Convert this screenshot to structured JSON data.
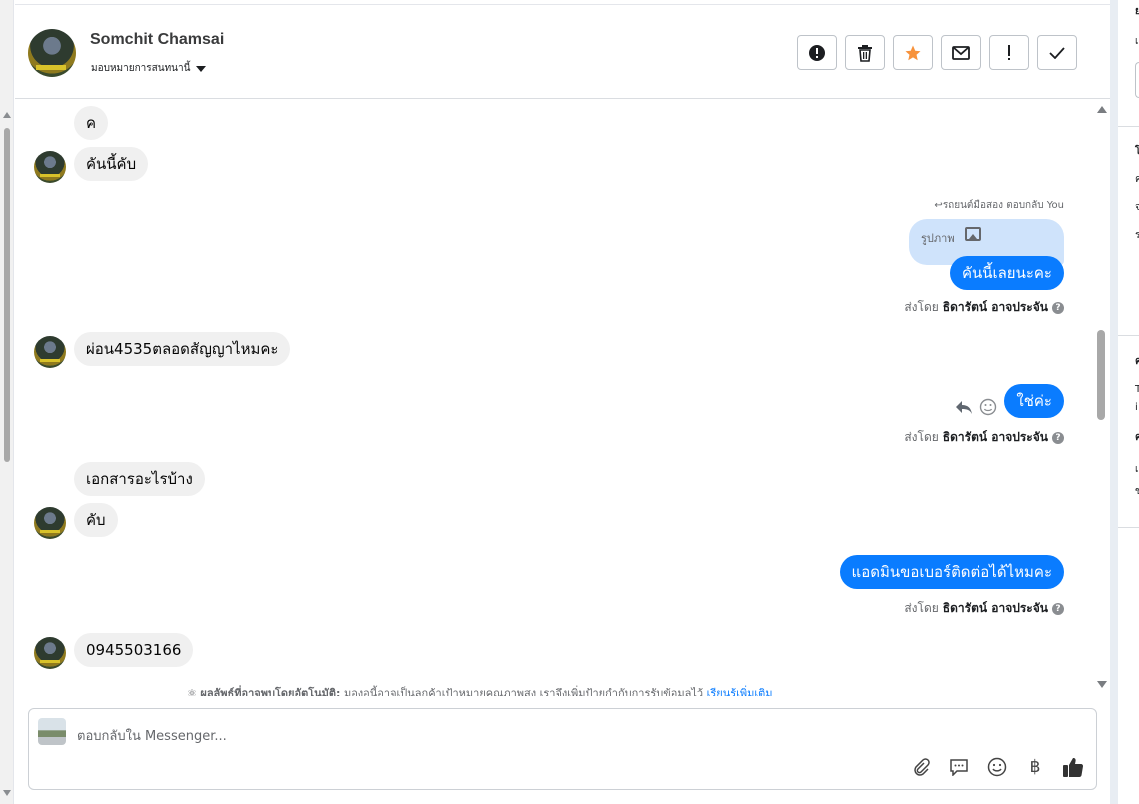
{
  "header": {
    "user_name": "Somchit Chamsai",
    "assign_label": "มอบหมายการสนทนานี้",
    "actions": [
      {
        "name": "spam-button",
        "icon": "alert-circle-icon"
      },
      {
        "name": "delete-button",
        "icon": "trash-icon"
      },
      {
        "name": "star-button",
        "icon": "star-icon"
      },
      {
        "name": "mark-unread-button",
        "icon": "envelope-icon"
      },
      {
        "name": "follow-up-button",
        "icon": "exclamation-icon"
      },
      {
        "name": "done-button",
        "icon": "check-icon"
      }
    ]
  },
  "messages": {
    "m1": "ค",
    "m2": "คันนี้คับ",
    "reply_note": "รถยนต์มือสอง ตอบกลับ You",
    "quoted_label": "รูปภาพ",
    "m3": "คันนี้เลยนะคะ",
    "m4": "ผ่อน4535ตลอดสัญญาไหมคะ",
    "m5": "ใช่ค่ะ",
    "m6": "เอกสารอะไรบ้าง",
    "m7": "คับ",
    "m8": "แอดมินขอเบอร์ติดต่อได้ไหมคะ",
    "m9": "0945503166",
    "sent_by_prefix": "ส่งโดย",
    "sender_name": "ธิดารัตน์ อาจประจัน",
    "help_glyph": "?",
    "system_bold": "ผลลัพธ์ที่อาจพบโดยอัตโนมัติ:",
    "system_text": "มองอนี้อาจเป็นลูกค้าเป้าหมายคุณภาพสูง เราจึงเพิ่มป้ายกำกับการรับข้อมูลไว้",
    "system_link": "เรียนรู้เพิ่มเติม"
  },
  "composer": {
    "placeholder": "ตอบกลับใน Messenger...",
    "tools": [
      "paperclip-icon",
      "speech-bubble-icon",
      "smiley-icon",
      "baht-icon",
      "thumbs-up-icon"
    ],
    "baht_glyph": "฿"
  },
  "right_panel": {
    "chars": [
      "ย",
      "เ",
      "โ",
      "ค",
      "จ",
      "ร",
      "ค",
      "T",
      "i",
      "ค",
      "เ",
      "ข"
    ]
  },
  "colors": {
    "accent": "#0a7cff",
    "star": "#f7923b",
    "incoming_bubble": "#f0f0f0",
    "quoted_bubble": "#cfe3fb"
  }
}
